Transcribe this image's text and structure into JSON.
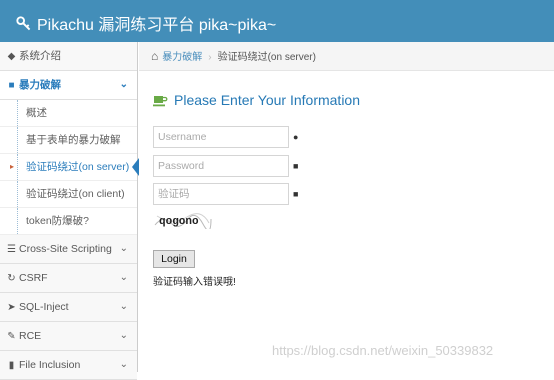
{
  "header": {
    "title": "Pikachu 漏洞练习平台 pika~pika~"
  },
  "sidebar": {
    "items": [
      {
        "label": "系统介绍",
        "icon": "tag-icon"
      },
      {
        "label": "暴力破解",
        "icon": "lock-icon",
        "open": true,
        "children": [
          {
            "label": "概述"
          },
          {
            "label": "基于表单的暴力破解"
          },
          {
            "label": "验证码绕过(on server)",
            "active": true
          },
          {
            "label": "验证码绕过(on client)"
          },
          {
            "label": "token防爆破?"
          }
        ]
      },
      {
        "label": "Cross-Site Scripting",
        "icon": "sitemap-icon"
      },
      {
        "label": "CSRF",
        "icon": "refresh-icon"
      },
      {
        "label": "SQL-Inject",
        "icon": "plug-icon"
      },
      {
        "label": "RCE",
        "icon": "pencil-icon"
      },
      {
        "label": "File Inclusion",
        "icon": "file-icon"
      }
    ]
  },
  "breadcrumb": {
    "parent": "暴力破解",
    "current": "验证码绕过(on server)"
  },
  "form": {
    "title": "Please Enter Your Information",
    "username_placeholder": "Username",
    "password_placeholder": "Password",
    "captcha_placeholder": "验证码",
    "captcha_text": "qogono",
    "login_label": "Login",
    "message": "验证码输入错误哦!"
  },
  "watermark": "https://blog.csdn.net/weixin_50339832",
  "colors": {
    "header": "#438eb9",
    "accent": "#2b7dbc",
    "heading_icon": "#69aa46"
  }
}
